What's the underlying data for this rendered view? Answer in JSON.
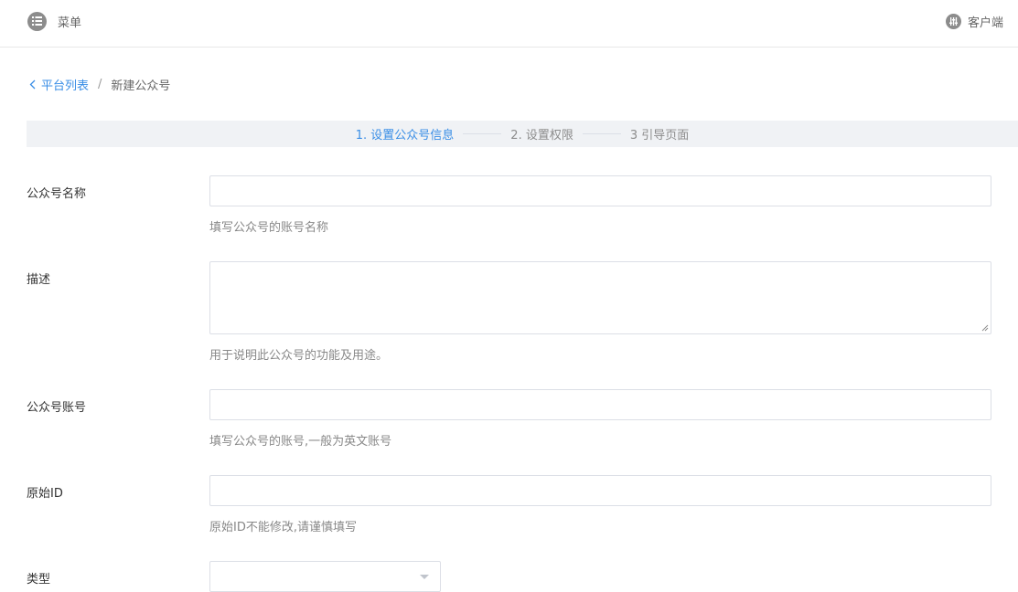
{
  "header": {
    "menu_label": "菜单",
    "client_label": "客户端",
    "menu_icon": "list-icon",
    "client_icon": "sliders-icon"
  },
  "breadcrumb": {
    "back_label": "平台列表",
    "separator": "/",
    "current": "新建公众号"
  },
  "steps": [
    {
      "label": "1. 设置公众号信息",
      "state": "active"
    },
    {
      "label": "2. 设置权限",
      "state": "todo"
    },
    {
      "label": "3 引导页面",
      "state": "todo"
    }
  ],
  "form": {
    "name": {
      "label": "公众号名称",
      "value": "",
      "hint": "填写公众号的账号名称"
    },
    "description": {
      "label": "描述",
      "value": "",
      "hint": "用于说明此公众号的功能及用途。"
    },
    "account": {
      "label": "公众号账号",
      "value": "",
      "hint": "填写公众号的账号,一般为英文账号"
    },
    "original_id": {
      "label": "原始ID",
      "value": "",
      "hint": "原始ID不能修改,请谨慎填写"
    },
    "type": {
      "label": "类型",
      "value": ""
    }
  },
  "colors": {
    "accent": "#3a8ee6",
    "step_bar_bg": "#f0f2f5",
    "border": "#dcdfe6"
  }
}
